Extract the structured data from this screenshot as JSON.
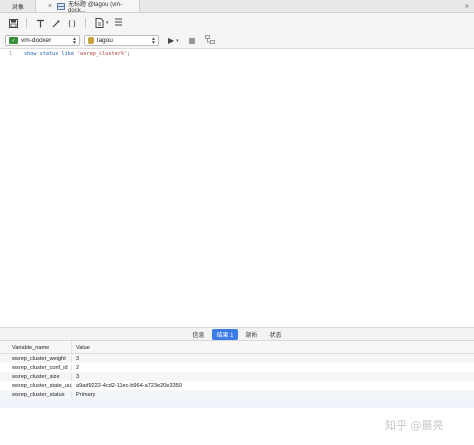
{
  "tabs": {
    "objects_label": "对象",
    "query_label": "无标题 @lagou (vm-dock...",
    "more_label": "»"
  },
  "toolbar": {
    "connection": "vm-docker",
    "database": "lagou"
  },
  "editor": {
    "line_number": "1",
    "code_keyword": "show status like",
    "code_string": "'wsrep_cluster%'",
    "code_end": ";"
  },
  "result_tabs": [
    "信息",
    "结果 1",
    "剖析",
    "状态"
  ],
  "active_result_tab": 1,
  "grid": {
    "columns": [
      "Variable_name",
      "Value"
    ],
    "rows": [
      [
        "wsrep_cluster_weight",
        "3"
      ],
      [
        "wsrep_cluster_conf_id",
        "2"
      ],
      [
        "wsrep_cluster_size",
        "3"
      ],
      [
        "wsrep_cluster_state_uuid",
        "a9ad9222-4cd2-11ec-b964-a723e20e3350"
      ],
      [
        "wsrep_cluster_status",
        "Primary"
      ]
    ]
  },
  "watermark": "知乎 @晨亮",
  "colors": {
    "accent": "#3b7be8",
    "keyword": "#1a5fb4",
    "string": "#b03a2e"
  }
}
